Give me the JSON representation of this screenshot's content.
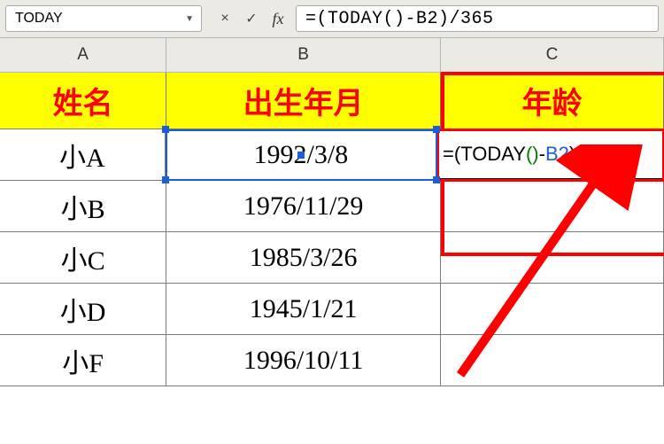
{
  "formula_bar": {
    "name_box": "TODAY",
    "cancel_icon": "×",
    "confirm_icon": "✓",
    "fx_icon": "fx",
    "formula_text": "=(TODAY()-B2)/365"
  },
  "columns": {
    "A": "A",
    "B": "B",
    "C": "C"
  },
  "headers": {
    "name": "姓名",
    "dob": "出生年月",
    "age": "年龄"
  },
  "rows": [
    {
      "name": "小A",
      "dob": "1992/3/8"
    },
    {
      "name": "小B",
      "dob": "1976/11/29"
    },
    {
      "name": "小C",
      "dob": "1985/3/26"
    },
    {
      "name": "小D",
      "dob": "1945/1/21"
    },
    {
      "name": "小F",
      "dob": "1996/10/11"
    }
  ],
  "editing_cell": {
    "prefix": "=(TODAY",
    "paren": "()",
    "mid": "-",
    "ref": "B2",
    "suffix": ")/3"
  }
}
